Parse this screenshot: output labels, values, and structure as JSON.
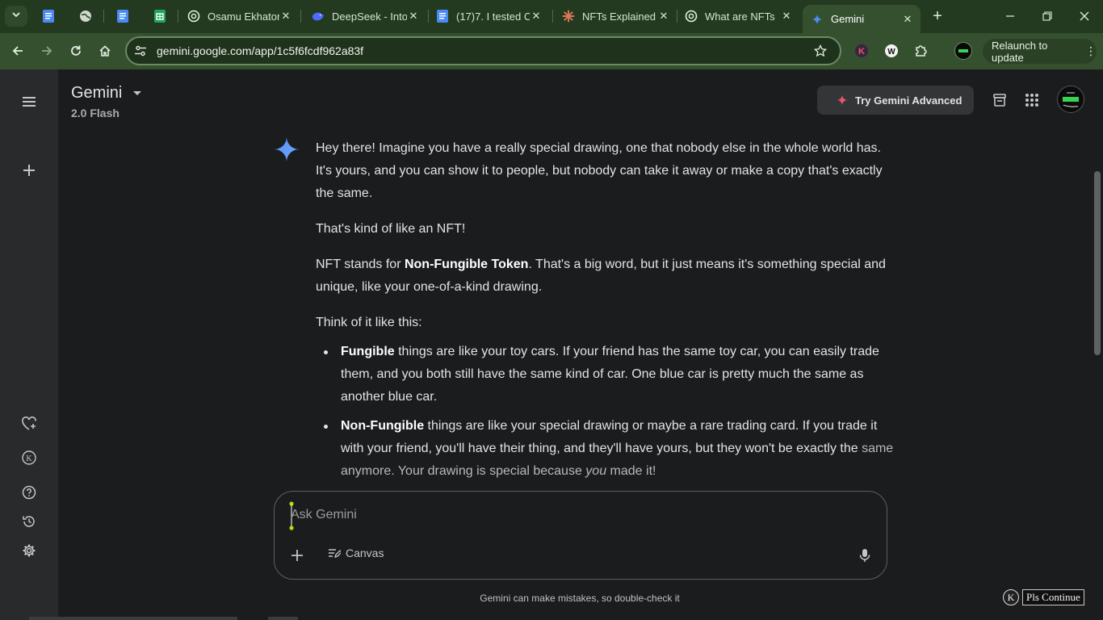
{
  "browser": {
    "tabs": [
      {
        "label": "",
        "icon": "google-docs-icon",
        "pinned": true
      },
      {
        "label": "",
        "icon": "globe-icon",
        "pinned": true
      },
      {
        "label": "",
        "icon": "google-docs-icon",
        "pinned": true
      },
      {
        "label": "",
        "icon": "google-sheets-icon",
        "pinned": true
      },
      {
        "label": "Osamu Ekhator",
        "icon": "chatgpt-icon"
      },
      {
        "label": "DeepSeek - Into",
        "icon": "deepseek-icon"
      },
      {
        "label": "(17)7. I tested C",
        "icon": "google-docs-icon"
      },
      {
        "label": "NFTs Explained",
        "icon": "claude-icon"
      },
      {
        "label": "What are NFTs",
        "icon": "chatgpt-icon"
      },
      {
        "label": "Gemini",
        "icon": "gemini-icon",
        "active": true
      }
    ],
    "url": "gemini.google.com/app/1c5f6fcdf962a83f",
    "relaunch_label": "Relaunch to update"
  },
  "app": {
    "title": "Gemini",
    "model": "2.0 Flash",
    "advanced_label": "Try Gemini Advanced"
  },
  "response": {
    "p1": "Hey there! Imagine you have a really special drawing, one that nobody else in the whole world has. It's yours, and you can show it to people, but nobody can take it away or make a copy that's exactly the same.",
    "p2": "That's kind of like an NFT!",
    "p3_pre": "NFT stands for ",
    "p3_bold": "Non-Fungible Token",
    "p3_post": ". That's a big word, but it just means it's something special and unique, like your one-of-a-kind drawing.",
    "p4": "Think of it like this:",
    "bullets": [
      {
        "bold": "Fungible",
        "text": " things are like your toy cars. If your friend has the same toy car, you can easily trade them, and you both still have the same kind of car. One blue car is pretty much the same as another blue car."
      },
      {
        "bold": "Non-Fungible",
        "text_a": " things are like your special drawing or maybe a rare trading card. If you trade it with your friend, you'll have their thing, and they'll have yours, but they won't be exactly the ",
        "text_b": "same anymore. Your drawing is special because ",
        "italic": "you",
        "text_c": " made it!"
      }
    ]
  },
  "composer": {
    "placeholder": "Ask Gemini",
    "canvas_label": "Canvas"
  },
  "disclaimer": "Gemini can make mistakes, so double-check it",
  "extension_button": {
    "badge": "K",
    "label": "Pls Continue"
  },
  "colors": {
    "tabstrip": "#233a20",
    "toolbar": "#35502f",
    "sidebar": "#282a2c",
    "main": "#1b1c1d",
    "gemini_blue": "#4c8df6"
  }
}
